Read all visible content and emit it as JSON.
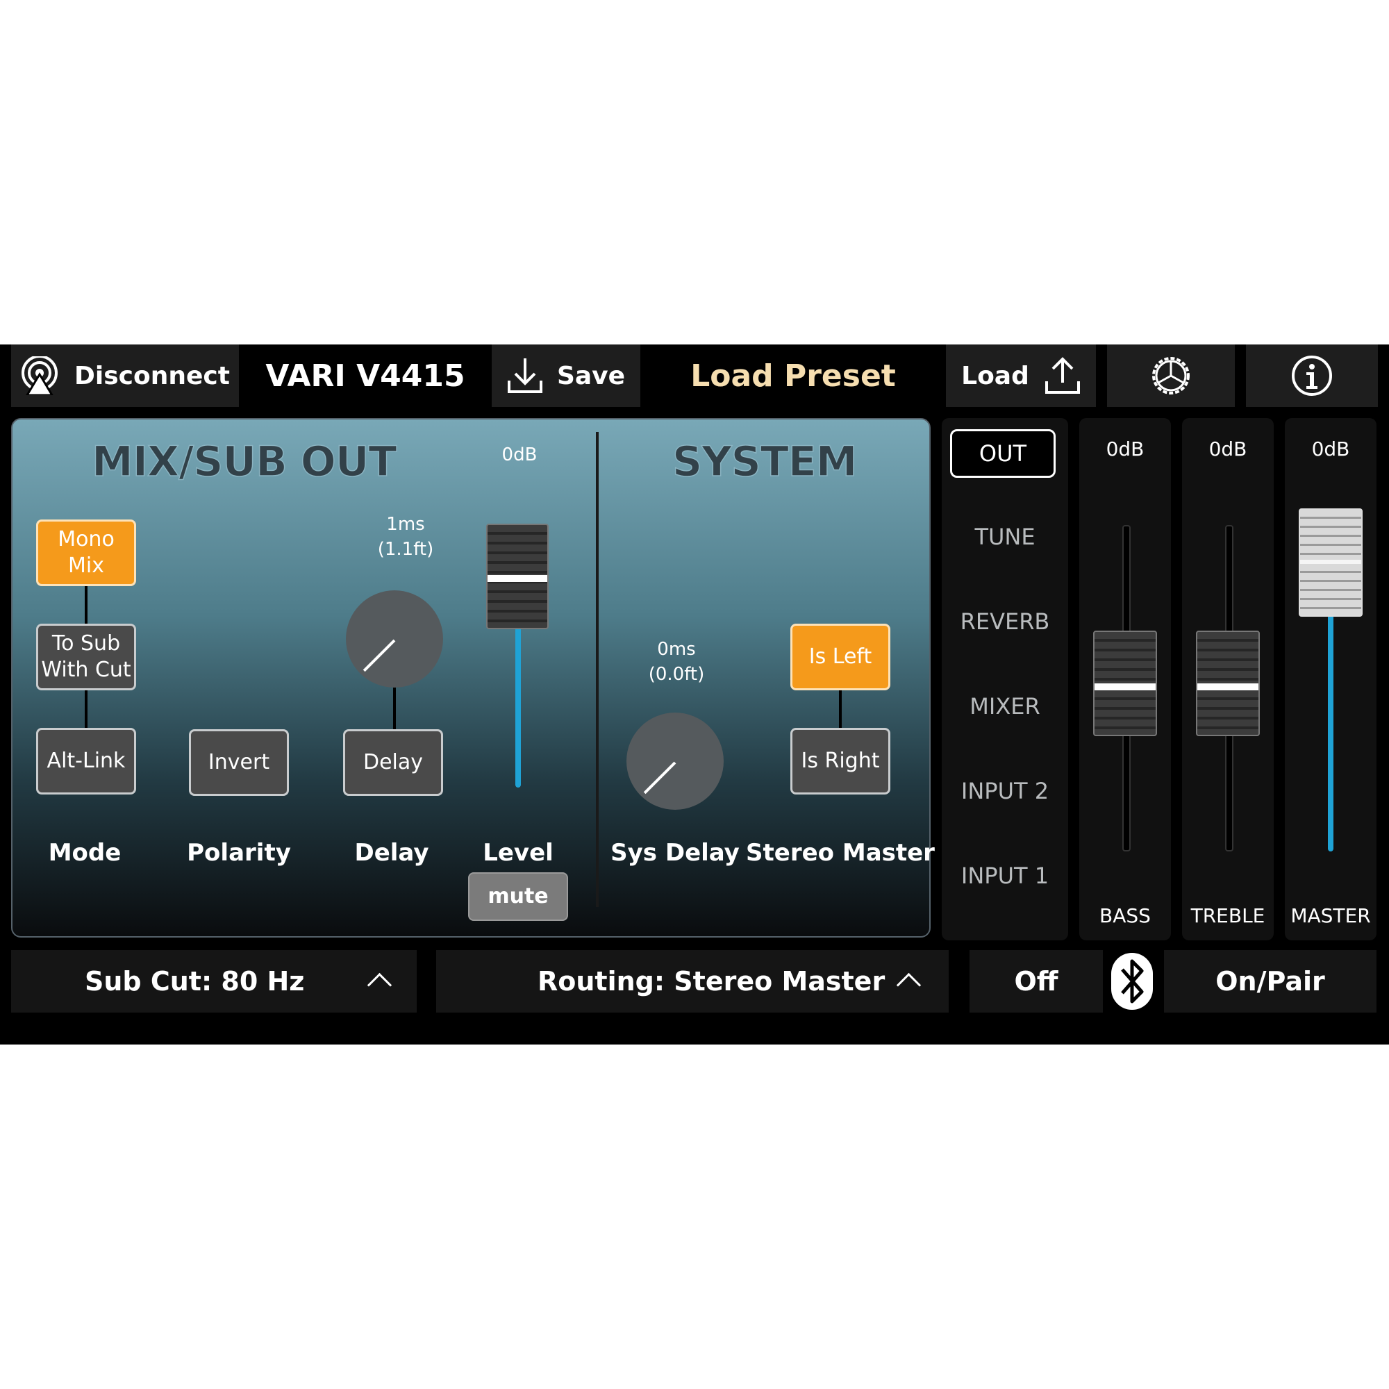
{
  "topbar": {
    "disconnect_label": "Disconnect",
    "device_name": "VARI V4415",
    "save_label": "Save",
    "load_preset_label": "Load Preset",
    "load_label": "Load"
  },
  "mixsub": {
    "heading": "MIX/SUB OUT",
    "mode_buttons": [
      "Mono Mix",
      "To Sub With Cut",
      "Alt-Link"
    ],
    "mode_active": "Mono Mix",
    "invert_label": "Invert",
    "delay_button_label": "Delay",
    "delay_value_ms": "1ms",
    "delay_value_ft": "(1.1ft)",
    "level_value": "0dB",
    "mute_label": "mute",
    "labels": {
      "mode": "Mode",
      "polarity": "Polarity",
      "delay": "Delay",
      "level": "Level"
    }
  },
  "system": {
    "heading": "SYSTEM",
    "sys_delay_ms": "0ms",
    "sys_delay_ft": "(0.0ft)",
    "is_left_label": "Is Left",
    "is_right_label": "Is Right",
    "stereo_master_active": "Is Left",
    "labels": {
      "sys_delay": "Sys Delay",
      "stereo_master": "Stereo Master"
    }
  },
  "nav": {
    "items": [
      "OUT",
      "TUNE",
      "REVERB",
      "MIXER",
      "INPUT 2",
      "INPUT 1"
    ],
    "active": "OUT"
  },
  "channels": [
    {
      "name": "BASS",
      "value": "0dB"
    },
    {
      "name": "TREBLE",
      "value": "0dB"
    },
    {
      "name": "MASTER",
      "value": "0dB"
    }
  ],
  "bottombar": {
    "sub_cut": "Sub Cut: 80 Hz",
    "routing": "Routing: Stereo Master",
    "bt_off": "Off",
    "bt_on_pair": "On/Pair"
  },
  "colors": {
    "accent_orange": "#f59a1b",
    "level_blue": "#1fa3d6",
    "preset_text": "#f6deb0"
  },
  "icons": [
    "broadcast-icon",
    "download-icon",
    "upload-icon",
    "settings-icon",
    "info-icon",
    "bluetooth-icon",
    "chevron-up-icon"
  ]
}
